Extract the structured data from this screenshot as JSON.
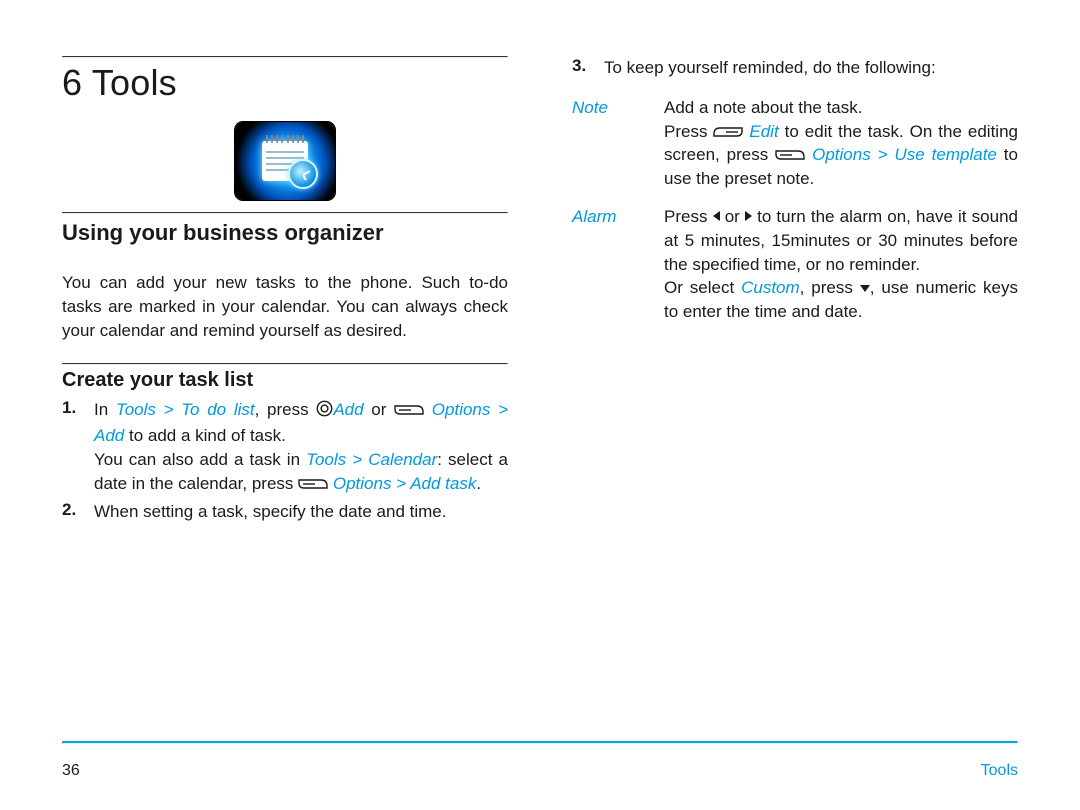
{
  "chapter": {
    "number": "6",
    "title": "Tools"
  },
  "section_title": "Using your business organizer",
  "section_body": "You can add your new tasks to the phone. Such to-do tasks are marked in your calendar. You can always check your calendar and remind yourself as desired.",
  "subsection_title": "Create your task list",
  "step1": {
    "num": "1.",
    "t1": "In ",
    "path1": "Tools > To do list",
    "t2": ", press ",
    "add": "Add",
    "t3": " or ",
    "opts_add": "Options > Add",
    "t4": " to add a kind of task.",
    "t5": "You can also add a task in ",
    "path2": "Tools > Calendar",
    "t6": ": select a date in the calendar, press ",
    "opts_addtask": "Options > Add task",
    "t7": "."
  },
  "step2": {
    "num": "2.",
    "body": "When setting a task, specify the date and time."
  },
  "step3": {
    "num": "3.",
    "body": "To keep yourself reminded, do the following:"
  },
  "defs": {
    "note_label": "Note",
    "note_line1": "Add a note about the task.",
    "note_t1": "Press ",
    "note_edit": "Edit",
    "note_t2": " to edit the task. On the editing screen, press ",
    "note_opts": "Options > Use template",
    "note_t3": " to use the preset note.",
    "alarm_label": "Alarm",
    "alarm_t1": "Press ",
    "alarm_t2": " or ",
    "alarm_t3": " to turn the alarm on, have it sound at 5 minutes, 15minutes or 30 minutes before the specified time, or no reminder.",
    "alarm_t4": "Or select ",
    "alarm_custom": "Custom",
    "alarm_t5": ", press ",
    "alarm_t6": ", use numeric keys to enter the time and date."
  },
  "footer": {
    "page": "36",
    "section": "Tools"
  },
  "icons": {
    "calendar": "calendar-clock-icon",
    "softkey_left": "softkey-left-icon",
    "softkey_right": "softkey-right-icon",
    "circle": "center-select-icon",
    "tri_left": "triangle-left-icon",
    "tri_right": "triangle-right-icon",
    "tri_down": "triangle-down-icon"
  }
}
